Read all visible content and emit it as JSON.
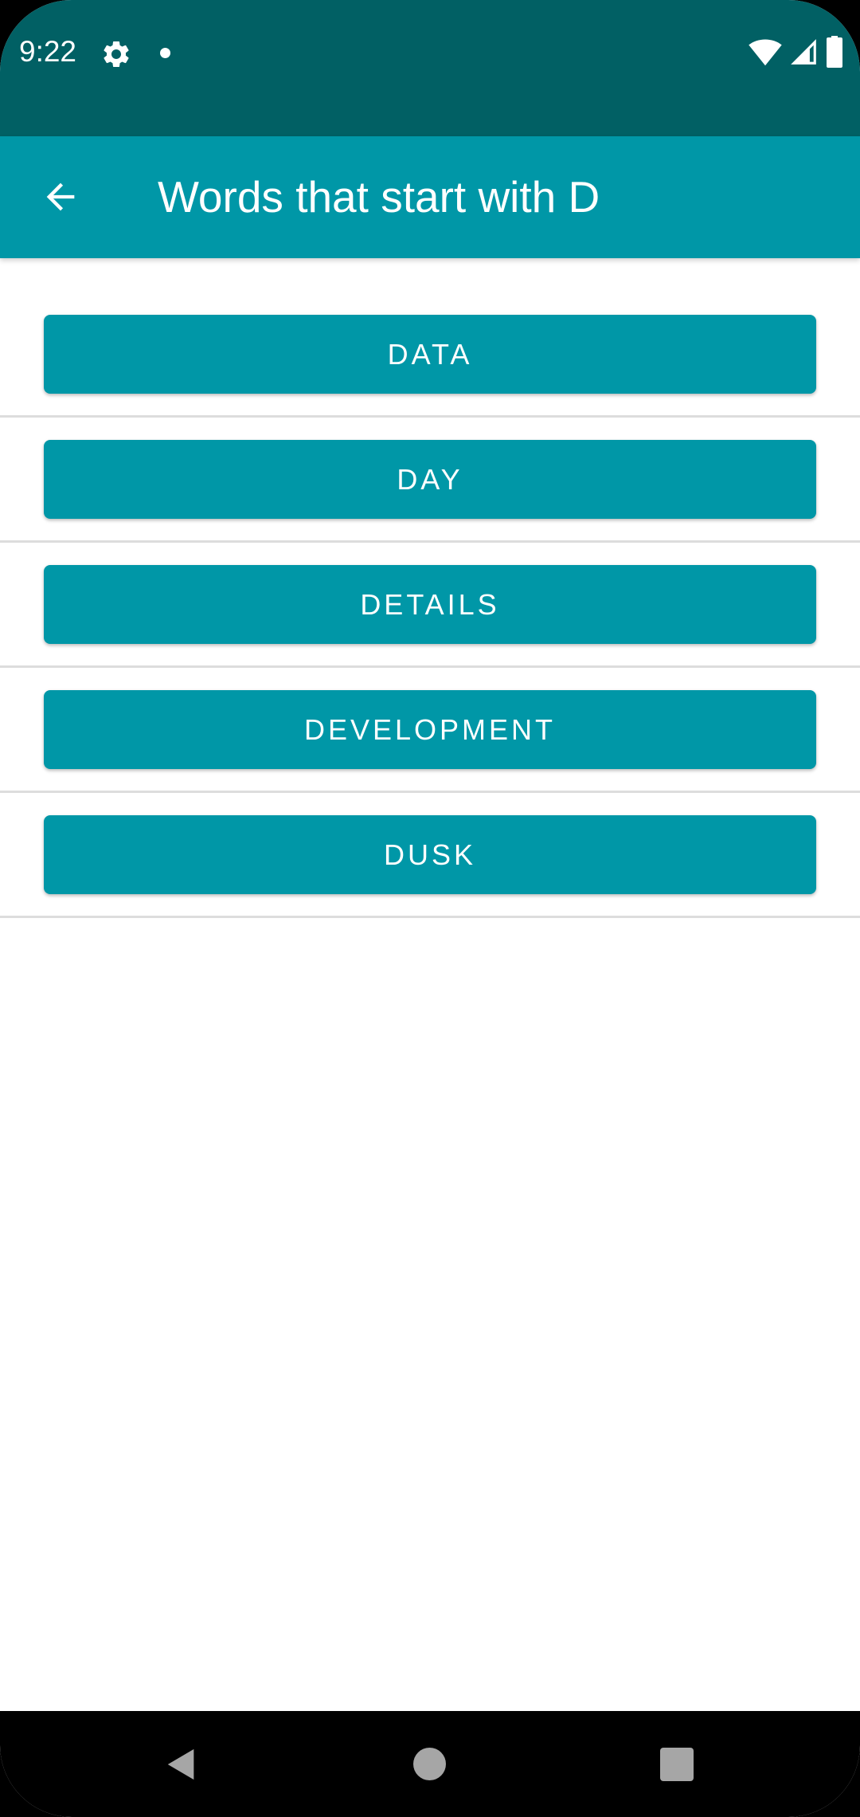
{
  "status_bar": {
    "time": "9:22",
    "icons": [
      "gear-icon",
      "notification-dot-icon",
      "wifi-icon",
      "signal-icon",
      "battery-icon"
    ],
    "background_color": "#016064"
  },
  "app_bar": {
    "title": "Words that start with D",
    "back_icon": "arrow-back-icon",
    "background_color": "#0097a7"
  },
  "words": [
    {
      "label": "DATA"
    },
    {
      "label": "DAY"
    },
    {
      "label": "DETAILS"
    },
    {
      "label": "DEVELOPMENT"
    },
    {
      "label": "DUSK"
    }
  ],
  "nav_bar": {
    "icons": [
      "nav-back-icon",
      "nav-home-icon",
      "nav-recents-icon"
    ]
  },
  "colors": {
    "accent": "#0097a7",
    "dark_accent": "#016064",
    "divider": "#dddddd"
  }
}
